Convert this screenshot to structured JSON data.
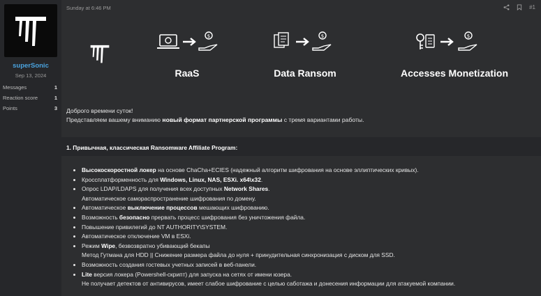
{
  "user": {
    "name": "superSonic",
    "joined": "Sep 13, 2024",
    "stats": [
      {
        "label": "Messages",
        "value": "1"
      },
      {
        "label": "Reaction score",
        "value": "1"
      },
      {
        "label": "Points",
        "value": "3"
      }
    ]
  },
  "post": {
    "timestamp": "Sunday at 6:46 PM",
    "number": "#1",
    "icons": [
      "share-icon",
      "bookmark-icon"
    ],
    "banner": {
      "features": [
        "RaaS",
        "Data Ransom",
        "Accesses Monetization"
      ]
    },
    "greeting": "Доброго времени суток!",
    "intro": {
      "pre": "Представляем вашему вниманию ",
      "bold": "новый формат партнерской программы",
      "post": " с тремя вариантами работы."
    },
    "section_title": "1. Привычная, классическая Ransomware Affiliate Program:",
    "items": [
      {
        "b1": "Высокоскоростной локер",
        "t1": " на основе ChaCha+ECIES (надежный алгоритм шифрования на основе эллиптических кривых).",
        "b2": "",
        "t2": "",
        "sub": ""
      },
      {
        "b1": "",
        "t1": "Кроссплатформенность для ",
        "b2": "Windows, Linux, NAS, ESXi. x64\\x32",
        "t2": ".",
        "sub": ""
      },
      {
        "b1": "",
        "t1": "Опрос LDAP/LDAPS для получения всех доступных ",
        "b2": "Network Shares",
        "t2": ".",
        "sub": "Автоматическое самораспространение шифрования по домену."
      },
      {
        "b1": "",
        "t1": "Автоматическое ",
        "b2": "выключение процессов",
        "t2": " мешающих шифрованию.",
        "sub": ""
      },
      {
        "b1": "",
        "t1": "Возможность ",
        "b2": "безопасно",
        "t2": " прервать процесс шифрования без уничтожения файла.",
        "sub": ""
      },
      {
        "b1": "",
        "t1": "Повышение привилегий до NT AUTHORITY\\SYSTEM.",
        "b2": "",
        "t2": "",
        "sub": ""
      },
      {
        "b1": "",
        "t1": "Автоматическое отключение VM в ESXi.",
        "b2": "",
        "t2": "",
        "sub": ""
      },
      {
        "b1": "",
        "t1": "Режим ",
        "b2": "Wipe",
        "t2": ", безвозвратно убивающий бекапы",
        "sub": "Метод Гутмана для HDD || Снижение размера файла до нуля + принудительная синхронизация с диском для SSD."
      },
      {
        "b1": "",
        "t1": "Возможность создания гостевых учетных записей в веб-панели.",
        "b2": "",
        "t2": "",
        "sub": ""
      },
      {
        "b1": "Lite",
        "t1": " версия локера (Powershell-скрипт) для запуска на сетях от имени юзера.",
        "b2": "",
        "t2": "",
        "sub": "Не получает детектов от антивирусов, имеет слабое шифрование с целью саботажа и донесения информации для атакуемой компании."
      }
    ]
  },
  "colors": {
    "accent": "#4aa3df",
    "background": "#2d2e30",
    "sidebar": "#26272a"
  }
}
